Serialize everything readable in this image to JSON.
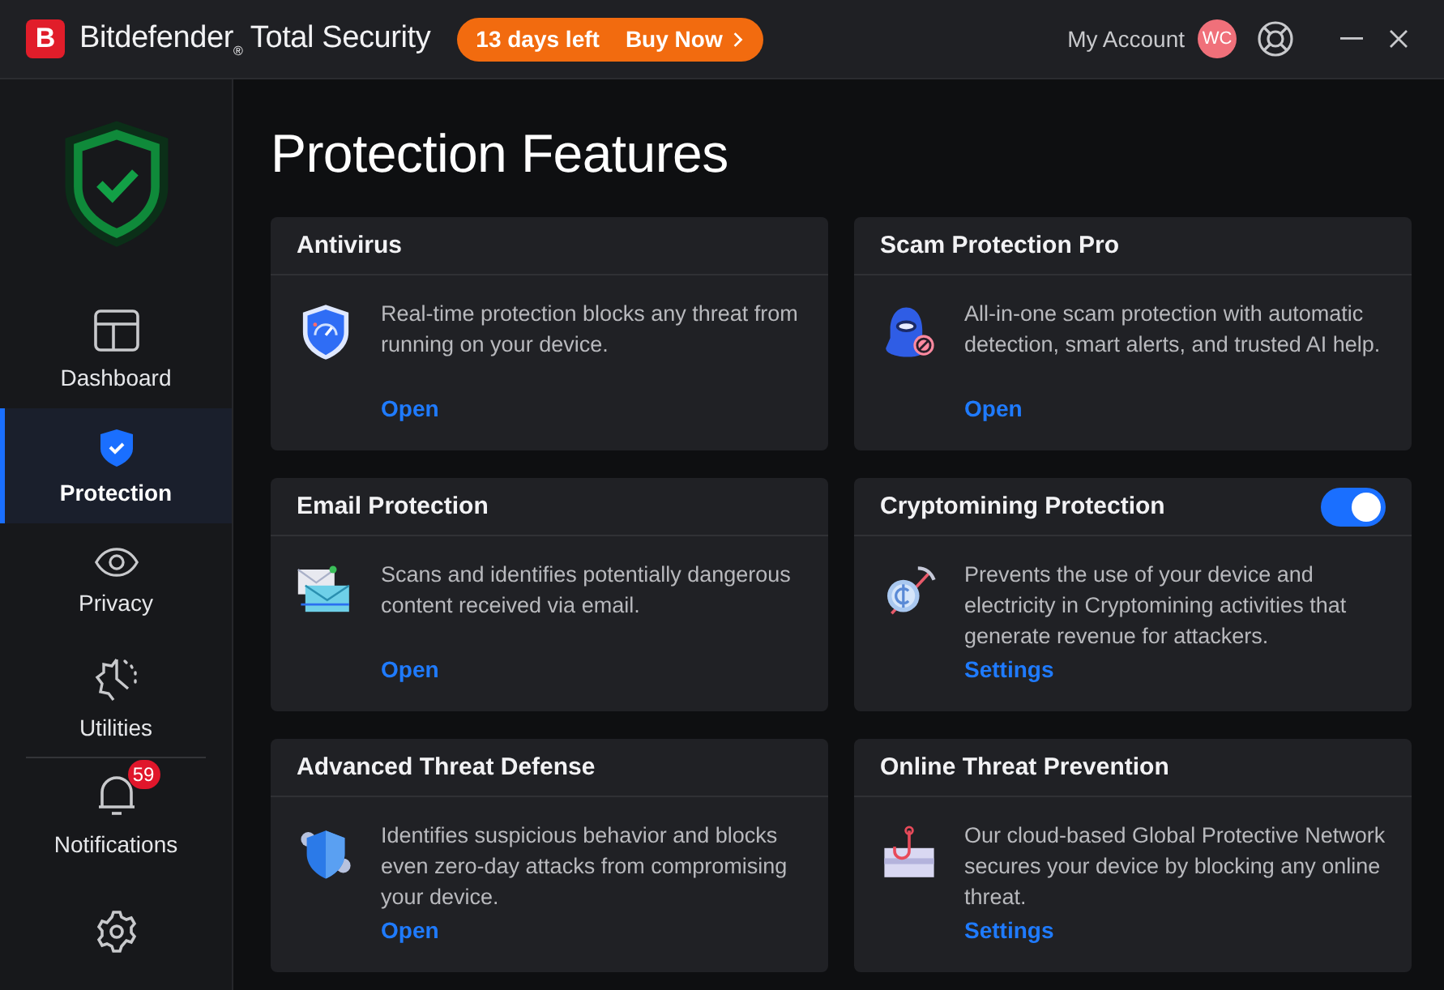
{
  "titlebar": {
    "logo_letter": "B",
    "title": "Bitdefender$_{®}$ Total Security",
    "trial": {
      "days_left": "13 days left",
      "button": "Buy Now"
    },
    "account": "My Account",
    "avatar": "WC"
  },
  "sidebar": {
    "items": [
      {
        "label": "Dashboard",
        "selected": false
      },
      {
        "label": "Protection",
        "selected": true
      },
      {
        "label": "Privacy",
        "selected": false
      },
      {
        "label": "Utilities",
        "selected": false
      },
      {
        "label": "Notifications",
        "selected": false,
        "badge": "59"
      },
      {
        "selected": false
      }
    ]
  },
  "page_title": "Protection Features",
  "cards": [
    {
      "title": "Antivirus",
      "description": "Real-time protection blocks any threat from running on your device.",
      "link": "Open"
    },
    {
      "title": "Scam Protection Pro",
      "description": "All-in-one scam protection with automatic detection, smart alerts, and trusted AI help.",
      "link": "Open"
    },
    {
      "title": "Email Protection",
      "description": "Scans and identifies potentially dangerous content received via email.",
      "link": "Open"
    },
    {
      "title": "Cryptomining Protection",
      "description": "Prevents the use of your device and electricity in Cryptomining activities that generate revenue for attackers.",
      "link": "Settings",
      "toggle": {
        "on": true
      }
    },
    {
      "title": "Advanced Threat Defense",
      "description": "Identifies suspicious behavior and blocks even zero-day attacks from compromising your device.",
      "link": "Open"
    },
    {
      "title": "Online Threat Prevention",
      "description": "Our cloud-based Global Protective Network secures your device by blocking any online threat.",
      "link": "Settings"
    }
  ]
}
